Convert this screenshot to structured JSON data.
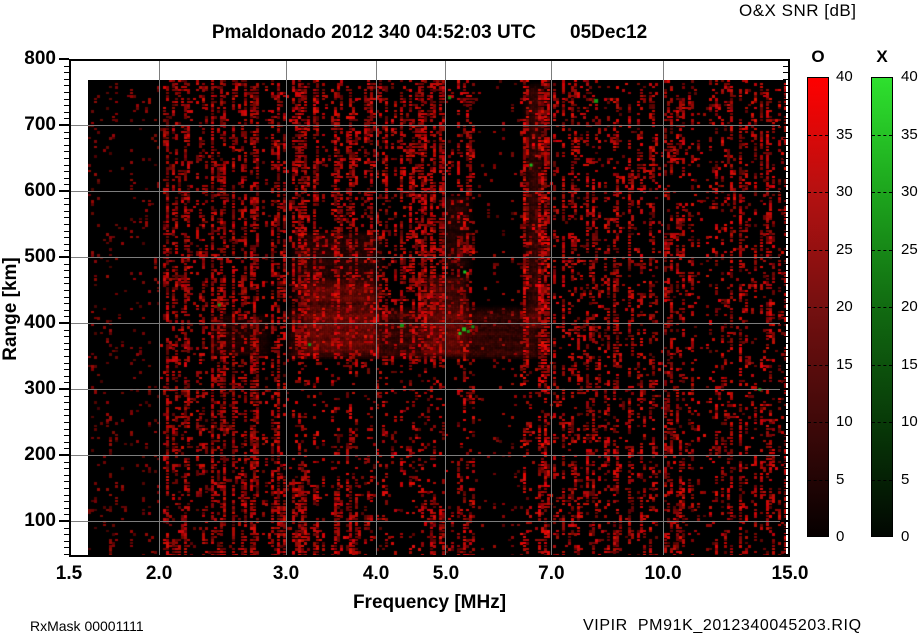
{
  "chart_data": {
    "type": "heatmap",
    "title": "Pmaldonado 2012 340 04:52:03 UTC",
    "date_label": "05Dec12",
    "xlabel": "Frequency [MHz]",
    "ylabel": "Range [km]",
    "x_scale": "log",
    "x_range_mhz": [
      1.5,
      15.0
    ],
    "x_ticks_mhz": [
      1.5,
      2.0,
      3.0,
      4.0,
      5.0,
      7.0,
      10.0,
      15.0
    ],
    "y_range_km": [
      45,
      800
    ],
    "y_ticks_km": [
      100,
      200,
      300,
      400,
      500,
      600,
      700,
      800
    ],
    "y_minor_step_km": 10,
    "grid": true,
    "footer_left": "RxMask 00001111",
    "footer_right": "VIPIR  PM91K_2012340045203.RIQ",
    "colorbar": {
      "title": "O&X SNR [dB]",
      "range_db": [
        0,
        40
      ],
      "ticks_db": [
        0,
        5,
        10,
        15,
        20,
        25,
        30,
        35,
        40
      ],
      "bars": [
        {
          "label": "O",
          "polarization": "ordinary",
          "stops": [
            [
              0,
              "#ff0000"
            ],
            [
              0.25,
              "#b51111"
            ],
            [
              0.5,
              "#751010"
            ],
            [
              0.78,
              "#390808"
            ],
            [
              1,
              "#060000"
            ]
          ]
        },
        {
          "label": "X",
          "polarization": "extraordinary",
          "stops": [
            [
              0,
              "#2ee02e"
            ],
            [
              0.25,
              "#1da51d"
            ],
            [
              0.5,
              "#116b11"
            ],
            [
              0.78,
              "#073407"
            ],
            [
              1,
              "#020702"
            ]
          ]
        }
      ]
    },
    "data_extent": {
      "f_min_mhz": 1.6,
      "f_max_mhz": 14.8,
      "km_min": 45,
      "km_max": 768
    },
    "noise_bands": [
      {
        "f0": 1.5,
        "f1": 2.0,
        "density": 0.1,
        "bright": 0.55
      },
      {
        "f0": 2.0,
        "f1": 2.9,
        "density": 0.3,
        "bright": 0.85
      },
      {
        "f0": 2.9,
        "f1": 4.05,
        "density": 0.33,
        "bright": 0.9
      },
      {
        "f0": 4.05,
        "f1": 5.5,
        "density": 0.3,
        "bright": 0.9
      },
      {
        "f0": 5.5,
        "f1": 6.3,
        "density": 0.07,
        "bright": 0.6
      },
      {
        "f0": 6.3,
        "f1": 6.95,
        "density": 0.45,
        "bright": 1.0
      },
      {
        "f0": 6.95,
        "f1": 15.0,
        "density": 0.24,
        "bright": 0.9
      }
    ],
    "dark_regions": [
      {
        "f0": 2.95,
        "f1": 3.9,
        "km0": 170,
        "km1": 345,
        "mult": 0.5
      },
      {
        "f0": 3.9,
        "f1": 4.7,
        "km0": 45,
        "km1": 335,
        "mult": 0.45
      },
      {
        "f0": 4.7,
        "f1": 5.4,
        "km0": 120,
        "km1": 340,
        "mult": 0.5
      },
      {
        "f0": 6.3,
        "f1": 6.95,
        "km0": 45,
        "km1": 330,
        "mult": 0.6
      }
    ],
    "echo_regions": [
      {
        "f0": 2.3,
        "f1": 2.9,
        "km0": 350,
        "km1": 420,
        "snr_db": 8
      },
      {
        "f0": 2.95,
        "f1": 6.9,
        "km0": 345,
        "km1": 430,
        "snr_db": 14
      },
      {
        "f0": 3.1,
        "f1": 4.1,
        "km0": 355,
        "km1": 470,
        "snr_db": 20
      },
      {
        "f0": 3.0,
        "f1": 4.15,
        "km0": 430,
        "km1": 545,
        "snr_db": 10
      },
      {
        "f0": 4.55,
        "f1": 5.45,
        "km0": 350,
        "km1": 480,
        "snr_db": 18
      },
      {
        "f0": 4.8,
        "f1": 5.5,
        "km0": 480,
        "km1": 600,
        "snr_db": 9
      },
      {
        "f0": 6.3,
        "f1": 6.95,
        "km0": 390,
        "km1": 770,
        "snr_db": 15
      }
    ],
    "x_mode_echo_dots": [
      {
        "f": 5.28,
        "km": 392
      },
      {
        "f": 5.36,
        "km": 388
      },
      {
        "f": 5.44,
        "km": 395
      },
      {
        "f": 5.22,
        "km": 385
      },
      {
        "f": 4.33,
        "km": 398
      },
      {
        "f": 3.23,
        "km": 368
      },
      {
        "f": 5.3,
        "km": 478
      },
      {
        "f": 5.05,
        "km": 742
      },
      {
        "f": 8.05,
        "km": 738
      },
      {
        "f": 6.55,
        "km": 640
      },
      {
        "f": 2.42,
        "km": 428
      },
      {
        "f": 13.6,
        "km": 300
      }
    ],
    "seed": 1205,
    "colors": {
      "grid": "#7d7d7d",
      "axis": "#000000",
      "background": "#ffffff",
      "noise_red": "#aa0f0a",
      "x_dot_green": "#159315"
    }
  }
}
